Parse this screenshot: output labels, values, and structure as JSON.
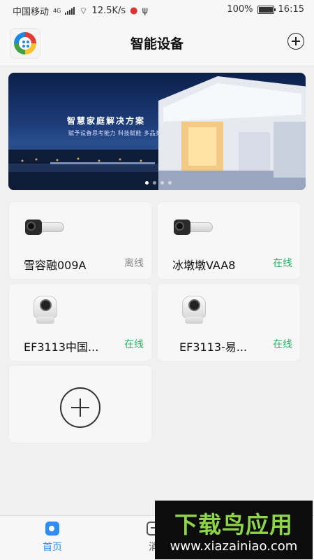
{
  "status_bar": {
    "carrier": "中国移动",
    "network": "4G",
    "speed": "12.5K/s",
    "battery": "100%",
    "time": "16:15"
  },
  "header": {
    "title": "智能设备",
    "logo_icon": "app-logo-icon",
    "add_icon": "plus-circle-icon"
  },
  "banner": {
    "title": "智慧家庭解决方案",
    "subtitle": "赋予设备思考能力 科技赋能 多品类",
    "pages": 4,
    "active_page": 0
  },
  "devices": [
    {
      "name": "雪容融009A",
      "status": "离线",
      "online": false,
      "type": "bullet-camera"
    },
    {
      "name": "冰墩墩VAA8",
      "status": "在线",
      "online": true,
      "type": "bullet-camera"
    },
    {
      "name": "EF3113中国...",
      "status": "在线",
      "online": true,
      "type": "dome-camera"
    },
    {
      "name": "EF3113-易...",
      "status": "在线",
      "online": true,
      "type": "dome-camera"
    }
  ],
  "add_device_icon": "plus-circle-icon",
  "bottom_nav": {
    "home_label": "首页",
    "message_label": "消"
  },
  "watermark": {
    "title": "下载鸟应用",
    "url": "www.xiazainiao.com"
  },
  "colors": {
    "online": "#2db36a",
    "offline": "#888888",
    "accent": "#2f8ef5",
    "watermark_green": "#8ed447"
  }
}
